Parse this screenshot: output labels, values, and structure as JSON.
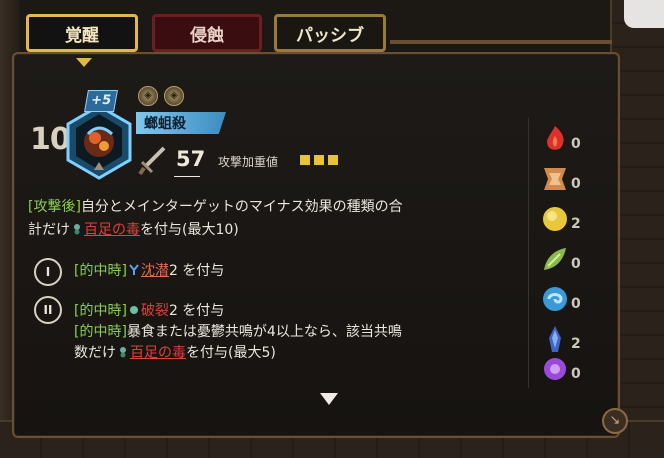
{
  "tabs": [
    {
      "label": "覚醒",
      "active": true
    },
    {
      "label": "侵蝕",
      "active": false
    },
    {
      "label": "パッシブ",
      "active": false
    }
  ],
  "character": {
    "level": "10",
    "plus": "+5",
    "name": "螂蛆殺",
    "attack": "57",
    "stat_label": "攻撃加重値",
    "stat_pips": 3
  },
  "description": {
    "main_tag": "[攻撃後]",
    "main_line1": "自分とメインターゲットのマイナス効果の種類の合",
    "main_line2_pre": "計だけ",
    "main_keyword": "百足の毒",
    "main_line2_post": "を付与(最大10)"
  },
  "effects": [
    {
      "numeral": "I",
      "tag": "[的中時]",
      "keyword": "沈潜",
      "text": "2 を付与"
    },
    {
      "numeral": "II",
      "tag": "[的中時]",
      "keyword": "破裂",
      "text": "2 を付与",
      "tag2": "[的中時]",
      "line2": "暴食または憂鬱共鳴が4以上なら、該当共鳴",
      "line3_pre": "数だけ",
      "keyword2": "百足の毒",
      "line3_post": "を付与(最大5)"
    }
  ],
  "elements": [
    {
      "name": "wrath",
      "count": "0",
      "color": "#d8322a"
    },
    {
      "name": "lust",
      "count": "0",
      "color": "#d08a4a"
    },
    {
      "name": "sloth",
      "count": "2",
      "color": "#e8c83a"
    },
    {
      "name": "gluttony",
      "count": "0",
      "color": "#8ab84a"
    },
    {
      "name": "gloom",
      "count": "0",
      "color": "#3a9ad8"
    },
    {
      "name": "pride",
      "count": "2",
      "color": "#3a66c8"
    },
    {
      "name": "envy",
      "count": "0",
      "color": "#9a4ad8"
    }
  ],
  "colors": {
    "gold": "#e2b84a",
    "tag_green": "#8bcf52",
    "keyword_red": "#e0403a",
    "keyword_blue": "#5aa0f0"
  }
}
